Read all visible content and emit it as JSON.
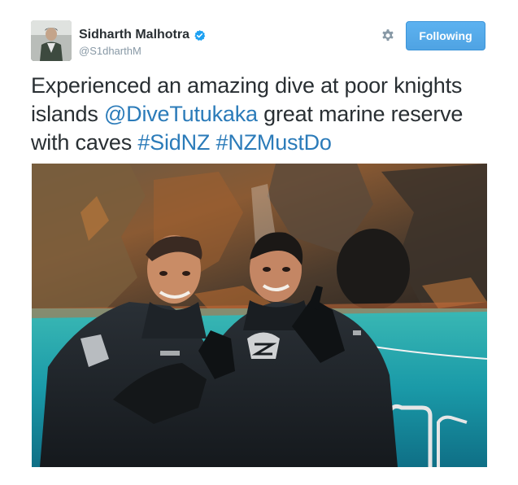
{
  "tweet": {
    "author_name": "Sidharth Malhotra",
    "author_handle": "@S1dharthM",
    "verified": true,
    "follow_button_label": "Following",
    "text_parts": {
      "line1": "Experienced an amazing dive at poor knights",
      "line2_pre": "islands ",
      "mention": "@DiveTutukaka",
      "line2_post": " great marine reserve",
      "line3_pre": "with caves ",
      "hashtag1": "#SidNZ",
      "space": " ",
      "hashtag2": "#NZMustDo"
    }
  },
  "icons": {
    "verified": "verified-badge-icon",
    "settings": "gear-icon"
  },
  "colors": {
    "follow_button": "#55acee",
    "link": "#2b7bb9",
    "text": "#292f33",
    "handle": "#8899a6",
    "verified": "#1da1f2"
  }
}
